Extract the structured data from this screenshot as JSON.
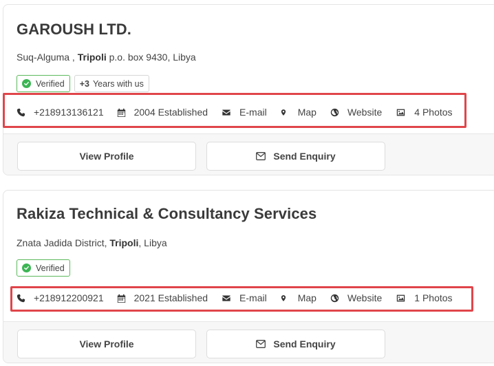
{
  "listings": [
    {
      "title": "GAROUSH LTD.",
      "address_pre": "Suq-Alguma , ",
      "address_city": "Tripoli",
      "address_post": " p.o. box 9430, Libya",
      "verified_label": "Verified",
      "years_count": "+3",
      "years_label": "Years with us",
      "phone": "+218913136121",
      "established": "2004 Established",
      "email_label": "E-mail",
      "map_label": "Map",
      "website_label": "Website",
      "photos": "4 Photos",
      "view_profile_label": "View Profile",
      "send_enquiry_label": "Send Enquiry"
    },
    {
      "title": "Rakiza Technical & Consultancy Services",
      "address_pre": "Znata Jadida District, ",
      "address_city": "Tripoli",
      "address_post": ", Libya",
      "verified_label": "Verified",
      "phone": "+218912200921",
      "established": "2021 Established",
      "email_label": "E-mail",
      "map_label": "Map",
      "website_label": "Website",
      "photos": "1 Photos",
      "view_profile_label": "View Profile",
      "send_enquiry_label": "Send Enquiry"
    }
  ],
  "colors": {
    "verified_green": "#3cb554",
    "highlight_red": "#e0454a",
    "footer_bg": "#f7f7f7"
  }
}
